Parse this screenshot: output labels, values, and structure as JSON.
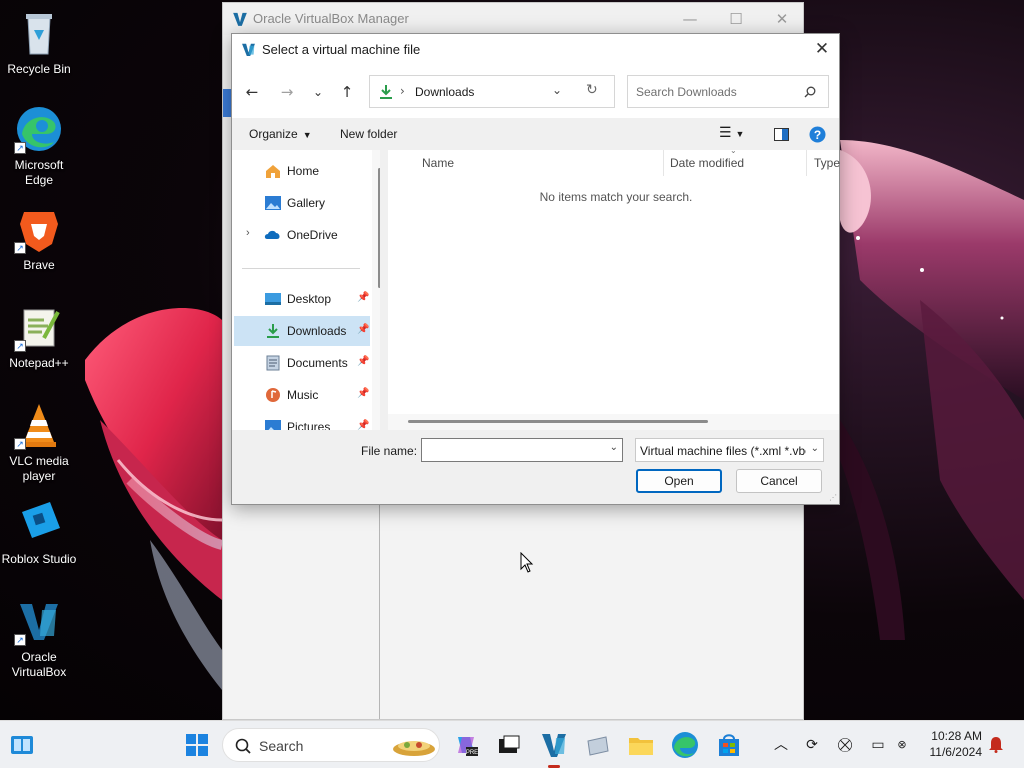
{
  "desktop": {
    "icons": [
      {
        "label": "Recycle Bin",
        "icon": "recycle-bin-icon"
      },
      {
        "label": "Microsoft Edge",
        "icon": "edge-icon"
      },
      {
        "label": "Brave",
        "icon": "brave-icon"
      },
      {
        "label": "Notepad++",
        "icon": "notepadpp-icon"
      },
      {
        "label": "VLC media player",
        "icon": "vlc-icon"
      },
      {
        "label": "Roblox Studio",
        "icon": "roblox-studio-icon"
      },
      {
        "label": "Oracle VirtualBox",
        "icon": "virtualbox-icon"
      }
    ]
  },
  "manager_window": {
    "title": "Oracle VirtualBox Manager",
    "controls": {
      "minimize": "—",
      "maximize": "☐",
      "close": "✕"
    }
  },
  "dialog": {
    "title": "Select a virtual machine file",
    "close": "✕",
    "nav": {
      "back": "←",
      "forward": "→",
      "recent": "⌄",
      "up": "↑",
      "refresh": "↻"
    },
    "address": {
      "separator": "›",
      "location": "Downloads"
    },
    "search": {
      "placeholder": "Search Downloads"
    },
    "commands": {
      "organize": "Organize",
      "new_folder": "New folder"
    },
    "nav_pane": [
      {
        "label": "Home",
        "icon": "home-icon",
        "pinned": false,
        "selected": false
      },
      {
        "label": "Gallery",
        "icon": "gallery-icon",
        "pinned": false,
        "selected": false
      },
      {
        "label": "OneDrive",
        "icon": "onedrive-icon",
        "pinned": false,
        "selected": false,
        "expandable": true
      },
      {
        "label": "Desktop",
        "icon": "desktop-folder-icon",
        "pinned": true,
        "selected": false
      },
      {
        "label": "Downloads",
        "icon": "downloads-icon",
        "pinned": true,
        "selected": true
      },
      {
        "label": "Documents",
        "icon": "documents-icon",
        "pinned": true,
        "selected": false
      },
      {
        "label": "Music",
        "icon": "music-icon",
        "pinned": true,
        "selected": false
      },
      {
        "label": "Pictures",
        "icon": "pictures-icon",
        "pinned": true,
        "selected": false
      }
    ],
    "columns": [
      "Name",
      "Date modified",
      "Type"
    ],
    "empty_message": "No items match your search.",
    "file_name_label": "File name:",
    "file_name_value": "",
    "file_type_filter": "Virtual machine files (*.xml *.vbox)",
    "buttons": {
      "open": "Open",
      "cancel": "Cancel"
    }
  },
  "taskbar": {
    "search_placeholder": "Search",
    "clock": {
      "time": "10:28 AM",
      "date": "11/6/2024"
    },
    "apps": [
      "widgets-icon",
      "start-icon",
      "copilot-icon",
      "terminal-icon",
      "virtualbox-icon",
      "vm-icon",
      "file-explorer-icon",
      "edge-icon",
      "store-icon"
    ],
    "tray": [
      "chevron-up-icon",
      "sync-icon",
      "network-icon",
      "monitor-icon",
      "notification-bell-icon"
    ]
  },
  "colors": {
    "accent": "#0067c0",
    "selection": "#cce3f5",
    "wallpaper_pink": "#e8375c",
    "notification_red": "#c42b1c"
  }
}
